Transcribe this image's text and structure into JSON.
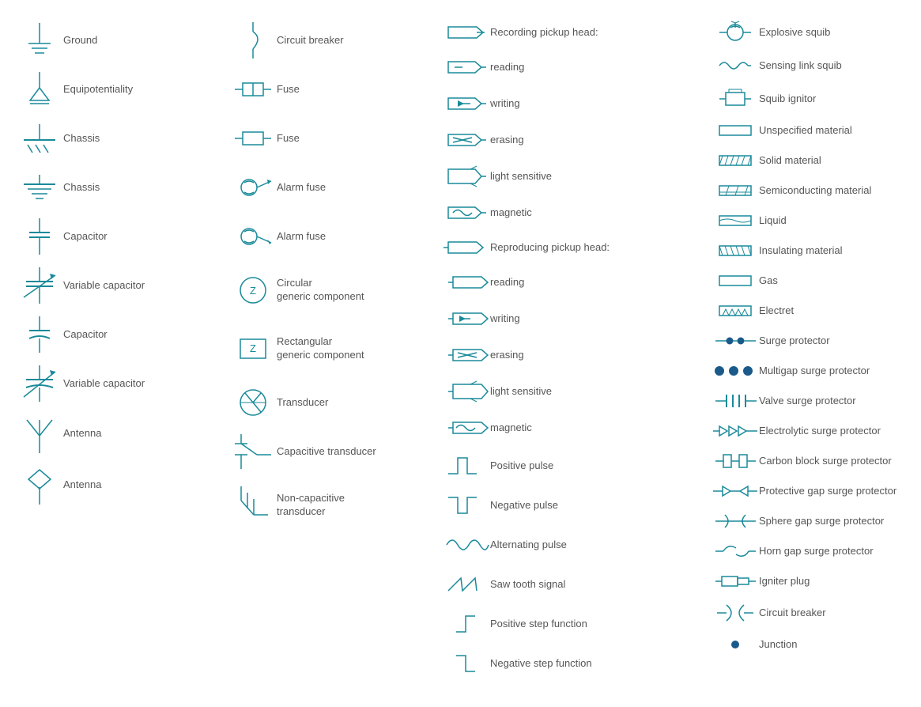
{
  "col1": {
    "items": [
      {
        "id": "ground",
        "label": "Ground"
      },
      {
        "id": "equipotentiality",
        "label": "Equipotentiality"
      },
      {
        "id": "chassis1",
        "label": "Chassis"
      },
      {
        "id": "chassis2",
        "label": "Chassis"
      },
      {
        "id": "capacitor1",
        "label": "Capacitor"
      },
      {
        "id": "variable-capacitor1",
        "label": "Variable capacitor"
      },
      {
        "id": "capacitor2",
        "label": "Capacitor"
      },
      {
        "id": "variable-capacitor2",
        "label": "Variable capacitor"
      },
      {
        "id": "antenna1",
        "label": "Antenna"
      },
      {
        "id": "antenna2",
        "label": "Antenna"
      }
    ]
  },
  "col2": {
    "items": [
      {
        "id": "circuit-breaker",
        "label": "Circuit breaker"
      },
      {
        "id": "fuse1",
        "label": "Fuse"
      },
      {
        "id": "fuse2",
        "label": "Fuse"
      },
      {
        "id": "alarm-fuse1",
        "label": "Alarm fuse"
      },
      {
        "id": "alarm-fuse2",
        "label": "Alarm fuse"
      },
      {
        "id": "circular-generic",
        "label": "Circular\ngeneric component"
      },
      {
        "id": "rectangular-generic",
        "label": "Rectangular\ngeneric component"
      },
      {
        "id": "transducer",
        "label": "Transducer"
      },
      {
        "id": "capacitive-transducer",
        "label": "Capacitive transducer"
      },
      {
        "id": "non-capacitive-transducer",
        "label": "Non-capacitive\ntransducer"
      }
    ]
  },
  "col3": {
    "groups": [
      {
        "header": "Recording pickup head:",
        "items": [
          {
            "id": "rec-reading",
            "label": "reading"
          },
          {
            "id": "rec-writing",
            "label": "writing"
          },
          {
            "id": "rec-erasing",
            "label": "erasing"
          },
          {
            "id": "rec-light",
            "label": "light sensitive"
          },
          {
            "id": "rec-magnetic",
            "label": "magnetic"
          }
        ]
      },
      {
        "header": "Reproducing pickup head:",
        "items": [
          {
            "id": "rep-reading",
            "label": "reading"
          },
          {
            "id": "rep-writing",
            "label": "writing"
          },
          {
            "id": "rep-erasing",
            "label": "erasing"
          },
          {
            "id": "rep-light",
            "label": "light sensitive"
          },
          {
            "id": "rep-magnetic",
            "label": "magnetic"
          }
        ]
      },
      {
        "header": null,
        "items": [
          {
            "id": "pos-pulse",
            "label": "Positive pulse"
          },
          {
            "id": "neg-pulse",
            "label": "Negative pulse"
          },
          {
            "id": "alt-pulse",
            "label": "Alternating pulse"
          },
          {
            "id": "saw-tooth",
            "label": "Saw tooth signal"
          },
          {
            "id": "pos-step",
            "label": "Positive step function"
          },
          {
            "id": "neg-step",
            "label": "Negative step function"
          }
        ]
      }
    ]
  },
  "col4": {
    "items": [
      {
        "id": "explosive-squib",
        "label": "Explosive squib"
      },
      {
        "id": "sensing-link-squib",
        "label": "Sensing link squib"
      },
      {
        "id": "squib-ignitor",
        "label": "Squib ignitor"
      },
      {
        "id": "unspecified-material",
        "label": "Unspecified material"
      },
      {
        "id": "solid-material",
        "label": "Solid material"
      },
      {
        "id": "semiconducting-material",
        "label": "Semiconducting material"
      },
      {
        "id": "liquid",
        "label": "Liquid"
      },
      {
        "id": "insulating-material",
        "label": "Insulating material"
      },
      {
        "id": "gas",
        "label": "Gas"
      },
      {
        "id": "electret",
        "label": "Electret"
      },
      {
        "id": "surge-protector",
        "label": "Surge protector"
      },
      {
        "id": "multigap-surge",
        "label": "Multigap surge protector"
      },
      {
        "id": "valve-surge",
        "label": "Valve surge protector"
      },
      {
        "id": "electrolytic-surge",
        "label": "Electrolytic surge protector"
      },
      {
        "id": "carbon-block-surge",
        "label": "Carbon block surge protector"
      },
      {
        "id": "protective-gap-surge",
        "label": "Protective gap surge protector"
      },
      {
        "id": "sphere-gap-surge",
        "label": "Sphere gap surge protector"
      },
      {
        "id": "horn-gap-surge",
        "label": "Horn gap surge protector"
      },
      {
        "id": "igniter-plug",
        "label": "Igniter plug"
      },
      {
        "id": "circuit-breaker2",
        "label": "Circuit breaker"
      },
      {
        "id": "junction",
        "label": "Junction"
      }
    ]
  }
}
